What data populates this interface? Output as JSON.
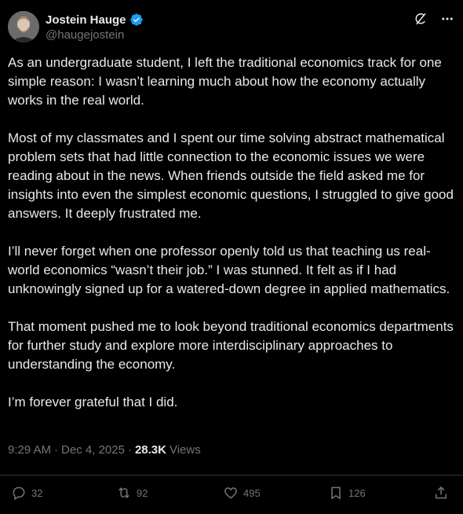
{
  "author": {
    "display_name": "Jostein Hauge",
    "handle": "@haugejostein",
    "verified": true
  },
  "icons": {
    "verified": "verified-badge-icon",
    "grok": "grok-icon",
    "more": "more-icon",
    "reply": "reply-icon",
    "repost": "repost-icon",
    "like": "like-icon",
    "bookmark": "bookmark-icon",
    "share": "share-icon"
  },
  "post": {
    "paragraphs": [
      "As an undergraduate student, I left the traditional economics track for one simple reason: I wasn’t learning much about how the economy actually works in the real world.",
      "Most of my classmates and I spent our time solving abstract mathematical problem sets that had little connection to the economic issues we were reading about in the news. When friends outside the field asked me for insights into even the simplest economic questions, I struggled to give good answers. It deeply frustrated me.",
      "I’ll never forget when one professor openly told us that teaching us real-world economics “wasn’t their job.” I was stunned. It felt as if I had unknowingly signed up for a watered-down degree in applied mathematics.",
      "That moment pushed me to look beyond traditional economics departments for further study and explore more interdisciplinary approaches to understanding the economy.",
      "I’m forever grateful that I did."
    ],
    "time": "9:29 AM",
    "separator": "·",
    "date": "Dec 4, 2025",
    "views_count": "28.3K",
    "views_label": "Views"
  },
  "actions": {
    "replies": "32",
    "reposts": "92",
    "likes": "495",
    "bookmarks": "126"
  },
  "colors": {
    "background": "#000000",
    "text": "#e7e9ea",
    "muted": "#71767b",
    "verified": "#1d9bf0",
    "border": "#2f3336"
  }
}
